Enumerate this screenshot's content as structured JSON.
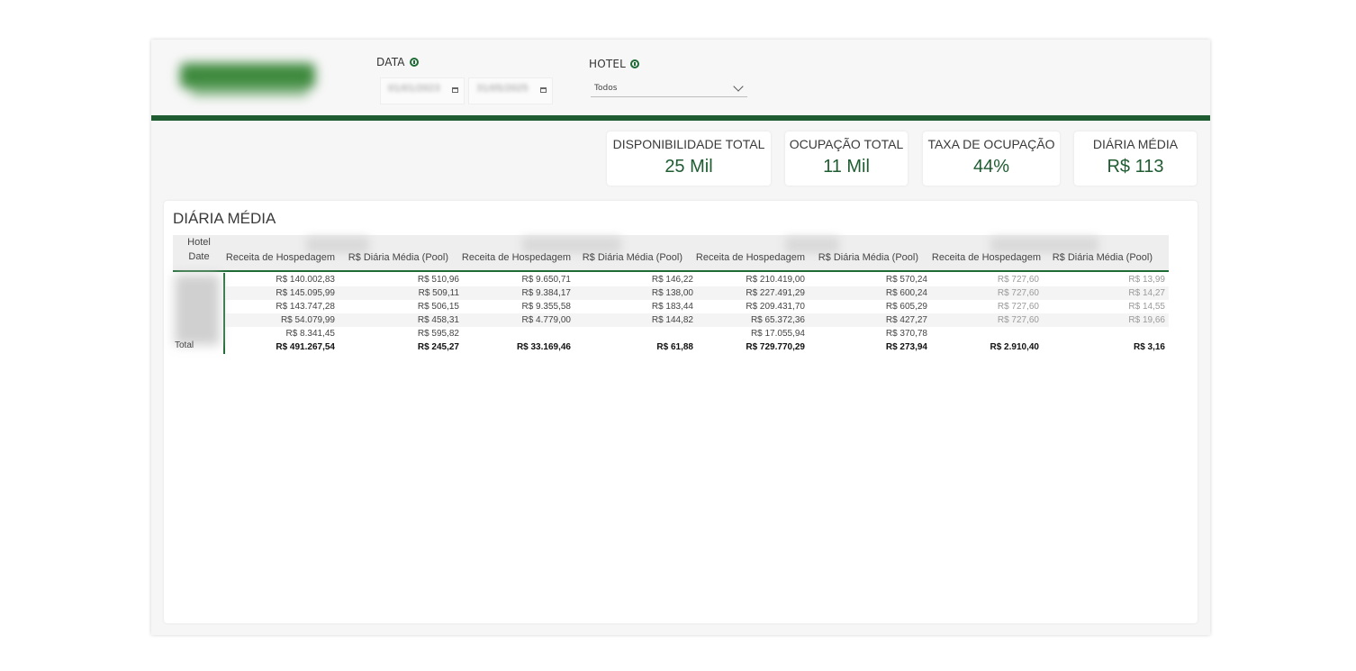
{
  "filters": {
    "date": {
      "label": "DATA",
      "start_value": "01/01/2023",
      "end_value": "31/05/2025"
    },
    "hotel": {
      "label": "HOTEL",
      "selected": "Todos"
    }
  },
  "kpis": [
    {
      "label": "DISPONIBILIDADE TOTAL",
      "value": "25 Mil"
    },
    {
      "label": "OCUPAÇÃO TOTAL",
      "value": "11 Mil"
    },
    {
      "label": "TAXA DE OCUPAÇÃO",
      "value": "44%"
    },
    {
      "label": "DIÁRIA MÉDIA",
      "value": "R$ 113"
    }
  ],
  "matrix": {
    "title": "DIÁRIA MÉDIA",
    "row_header_top": "Hotel",
    "row_header_bottom": "Date",
    "column_headers": [
      "Receita de Hospedagem",
      "R$ Diária Média (Pool)",
      "Receita de Hospedagem",
      "R$ Diária Média (Pool)",
      "Receita de Hospedagem",
      "R$ Diária Média (Pool)",
      "Receita de Hospedagem",
      "R$ Diária Média (Pool)"
    ],
    "rows": [
      [
        "R$ 140.002,83",
        "R$ 510,96",
        "R$ 9.650,71",
        "R$ 146,22",
        "R$ 210.419,00",
        "R$ 570,24",
        "R$ 727,60",
        "R$ 13,99"
      ],
      [
        "R$ 145.095,99",
        "R$ 509,11",
        "R$ 9.384,17",
        "R$ 138,00",
        "R$ 227.491,29",
        "R$ 600,24",
        "R$ 727,60",
        "R$ 14,27"
      ],
      [
        "R$ 143.747,28",
        "R$ 506,15",
        "R$ 9.355,58",
        "R$ 183,44",
        "R$ 209.431,70",
        "R$ 605,29",
        "R$ 727,60",
        "R$ 14,55"
      ],
      [
        "R$ 54.079,99",
        "R$ 458,31",
        "R$ 4.779,00",
        "R$ 144,82",
        "R$ 65.372,36",
        "R$ 427,27",
        "R$ 727,60",
        "R$ 19,66"
      ],
      [
        "R$ 8.341,45",
        "R$ 595,82",
        "",
        "",
        "R$ 17.055,94",
        "R$ 370,78",
        "",
        ""
      ]
    ],
    "total_label": "Total",
    "totals": [
      "R$ 491.267,54",
      "R$ 245,27",
      "R$ 33.169,46",
      "R$ 61,88",
      "R$ 729.770,29",
      "R$ 273,94",
      "R$ 2.910,40",
      "R$ 3,16"
    ]
  }
}
